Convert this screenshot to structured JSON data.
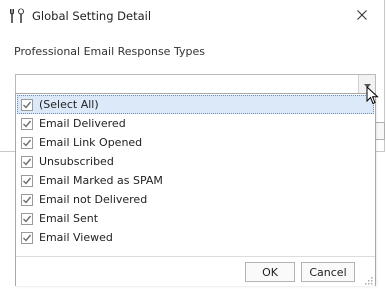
{
  "window": {
    "title": "Global Setting Detail",
    "close_icon": "close-icon",
    "title_icon": "tools-icon"
  },
  "form": {
    "field_label": "Professional Email Response Types",
    "combo_value": ""
  },
  "popup": {
    "items": [
      {
        "label": "(Select All)",
        "checked": true
      },
      {
        "label": "Email Delivered",
        "checked": true
      },
      {
        "label": "Email Link Opened",
        "checked": true
      },
      {
        "label": "Unsubscribed",
        "checked": true
      },
      {
        "label": "Email Marked as SPAM",
        "checked": true
      },
      {
        "label": "Email not Delivered",
        "checked": true
      },
      {
        "label": "Email Sent",
        "checked": true
      },
      {
        "label": "Email Viewed",
        "checked": true
      }
    ],
    "ok_label": "OK",
    "cancel_label": "Cancel"
  },
  "colors": {
    "highlight": "#dbe9f8",
    "check": "#6d6d6d"
  }
}
